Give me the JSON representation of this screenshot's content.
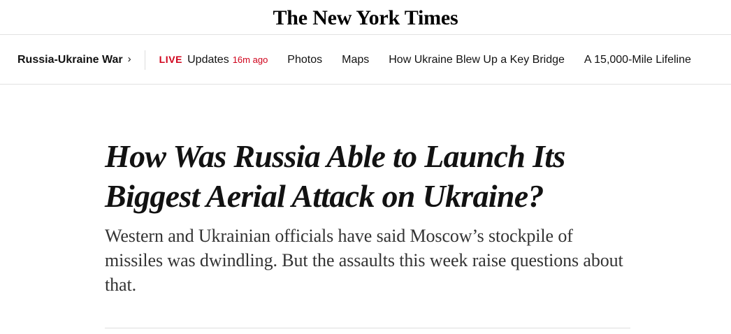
{
  "masthead": {
    "logo_text": "The New York Times"
  },
  "navigation": {
    "section_label": "Russia-Ukraine War",
    "live_label": "LIVE",
    "updates_label": "Updates",
    "updated_time": "16m ago",
    "items": [
      "Photos",
      "Maps",
      "How Ukraine Blew Up a Key Bridge",
      "A 15,000-Mile Lifeline"
    ],
    "live_color": "#d0021b"
  },
  "article": {
    "headline": "How Was Russia Able to Launch Its Biggest Aerial Attack on Ukraine?",
    "summary": "Western and Ukrainian officials have said Moscow’s stockpile of missiles was dwindling. But the assaults this week raise questions about that."
  }
}
